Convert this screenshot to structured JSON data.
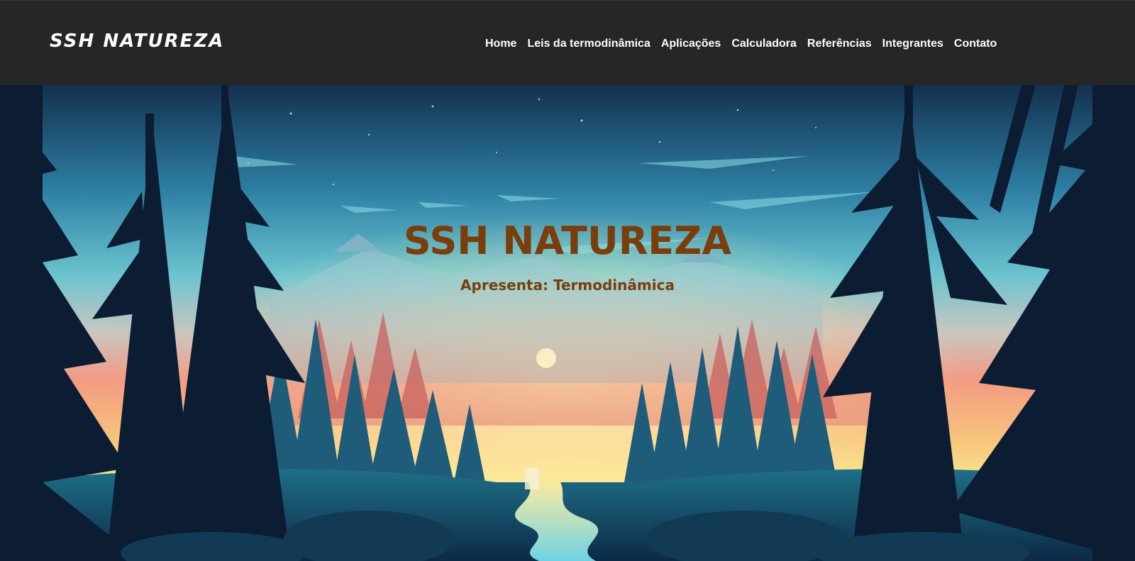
{
  "header": {
    "logo": "SSH NATUREZA",
    "nav": [
      {
        "label": "Home"
      },
      {
        "label": "Leis da termodinâmica"
      },
      {
        "label": "Aplicações"
      },
      {
        "label": "Calculadora"
      },
      {
        "label": "Referências"
      },
      {
        "label": "Integrantes"
      },
      {
        "label": "Contato"
      }
    ]
  },
  "hero": {
    "title": "SSH NATUREZA",
    "subtitle": "Apresenta: Termodinâmica",
    "background": "forest-sunset-illustration"
  },
  "colors": {
    "header_bg": "#262626",
    "header_text": "#ffffff",
    "hero_text": "#7a3e0c"
  }
}
